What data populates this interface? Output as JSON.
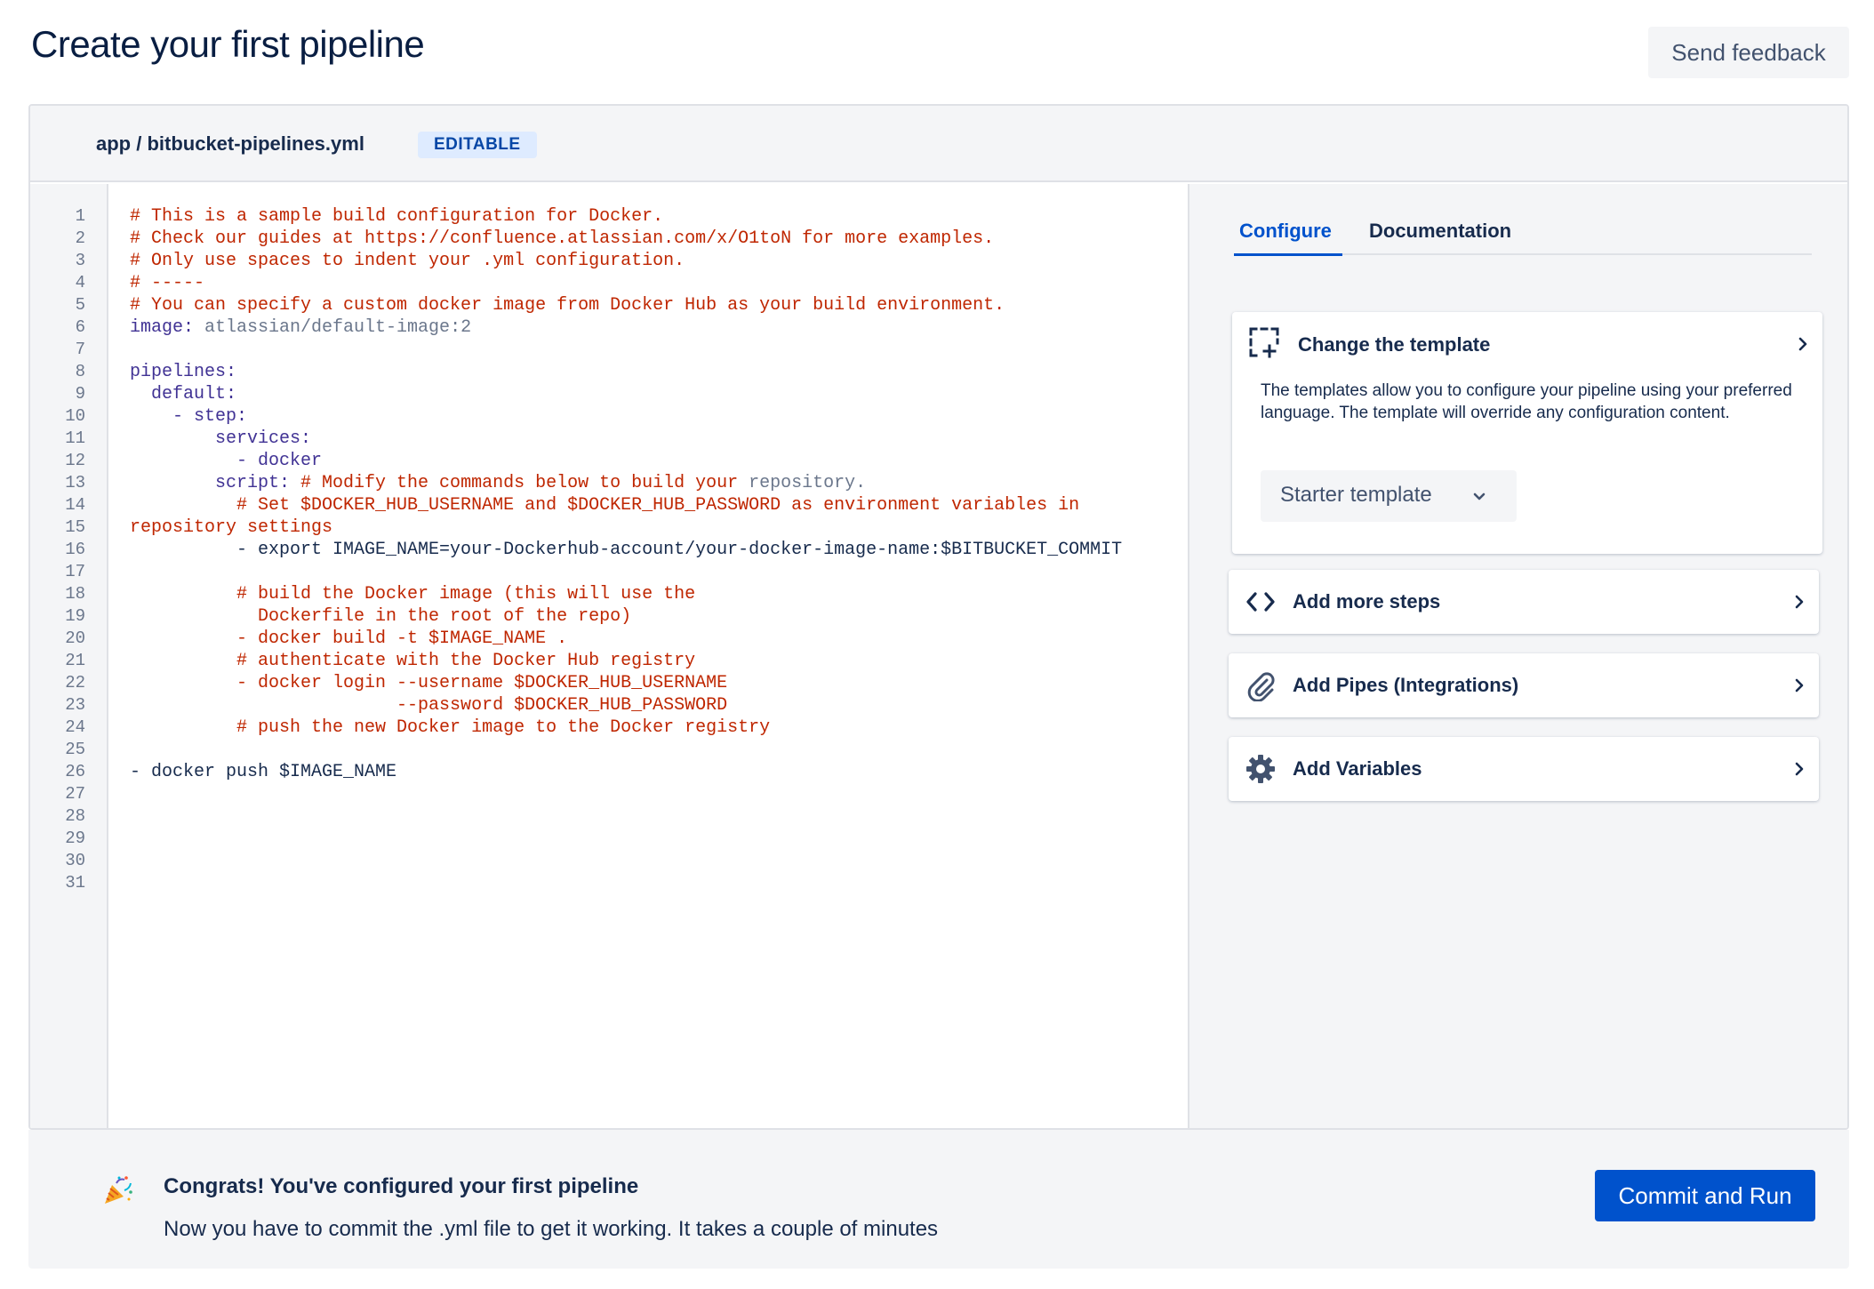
{
  "page": {
    "title": "Create your first pipeline",
    "feedback_label": "Send feedback"
  },
  "file": {
    "path": "app / bitbucket-pipelines.yml",
    "badge": "EDITABLE"
  },
  "editor": {
    "line_count": 31,
    "lines": [
      [
        {
          "t": "# This is a sample build configuration for Docker.",
          "c": "comment"
        }
      ],
      [
        {
          "t": "# Check our guides at https://confluence.atlassian.com/x/O1toN for more examples.",
          "c": "comment"
        }
      ],
      [
        {
          "t": "# Only use spaces to indent your .yml configuration.",
          "c": "comment"
        }
      ],
      [
        {
          "t": "# -----",
          "c": "comment"
        }
      ],
      [
        {
          "t": "# You can specify a custom docker image from Docker Hub as your build environment.",
          "c": "comment"
        }
      ],
      [
        {
          "t": "image:",
          "c": "key"
        },
        {
          "t": " atlassian/default-image:2",
          "c": "val"
        }
      ],
      [],
      [
        {
          "t": "pipelines:",
          "c": "key"
        }
      ],
      [
        {
          "t": "  default:",
          "c": "key"
        }
      ],
      [
        {
          "t": "    - step:",
          "c": "key"
        }
      ],
      [
        {
          "t": "        services:",
          "c": "key"
        }
      ],
      [
        {
          "t": "          - docker",
          "c": "key"
        }
      ],
      [
        {
          "t": "        script:",
          "c": "key"
        },
        {
          "t": " # Modify the commands below to build your",
          "c": "comment"
        },
        {
          "t": " repository.",
          "c": "val"
        }
      ],
      [
        {
          "t": "          # Set $DOCKER_HUB_USERNAME and $DOCKER_HUB_PASSWORD as environment variables in",
          "c": "comment"
        }
      ],
      [
        {
          "t": "repository settings",
          "c": "comment"
        }
      ],
      [
        {
          "t": "          - export IMAGE_NAME=your-Dockerhub-account/your-docker-image-name:$BITBUCKET_COMMIT",
          "c": "plain"
        }
      ],
      [],
      [
        {
          "t": "          # build the Docker image (this will use the",
          "c": "comment"
        }
      ],
      [
        {
          "t": "            Dockerfile in the root of the repo)",
          "c": "comment"
        }
      ],
      [
        {
          "t": "          - docker build -t $IMAGE_NAME .",
          "c": "comment"
        }
      ],
      [
        {
          "t": "          # authenticate with the Docker Hub registry",
          "c": "comment"
        }
      ],
      [
        {
          "t": "          - docker login --username $DOCKER_HUB_USERNAME",
          "c": "comment"
        }
      ],
      [
        {
          "t": "                         --password $DOCKER_HUB_PASSWORD",
          "c": "comment"
        }
      ],
      [
        {
          "t": "          # push the new Docker image to the Docker registry",
          "c": "comment"
        }
      ],
      [],
      [
        {
          "t": "- docker push $IMAGE_NAME",
          "c": "plain"
        }
      ],
      [],
      [],
      [],
      [],
      []
    ]
  },
  "sidebar": {
    "tabs": [
      "Configure",
      "Documentation"
    ],
    "active_tab": "Configure",
    "template_card": {
      "title": "Change the template",
      "description": "The templates allow you to configure your pipeline using your preferred language. The template will override any configuration content.",
      "select_value": "Starter template",
      "icon": "add-template-icon"
    },
    "cards": [
      {
        "title": "Add more steps",
        "icon": "code-icon"
      },
      {
        "title": "Add Pipes (Integrations)",
        "icon": "paperclip-icon"
      },
      {
        "title": "Add Variables",
        "icon": "gear-icon"
      }
    ]
  },
  "footer": {
    "title": "Congrats! You've configured your first pipeline",
    "subtitle": "Now you have to commit the .yml file to get it working. It takes a couple of minutes",
    "button_label": "Commit and Run",
    "icon": "party-popper-icon"
  },
  "colors": {
    "accent": "#0052CC",
    "comment": "#BF2600",
    "key": "#403294",
    "value": "#6B778C"
  }
}
